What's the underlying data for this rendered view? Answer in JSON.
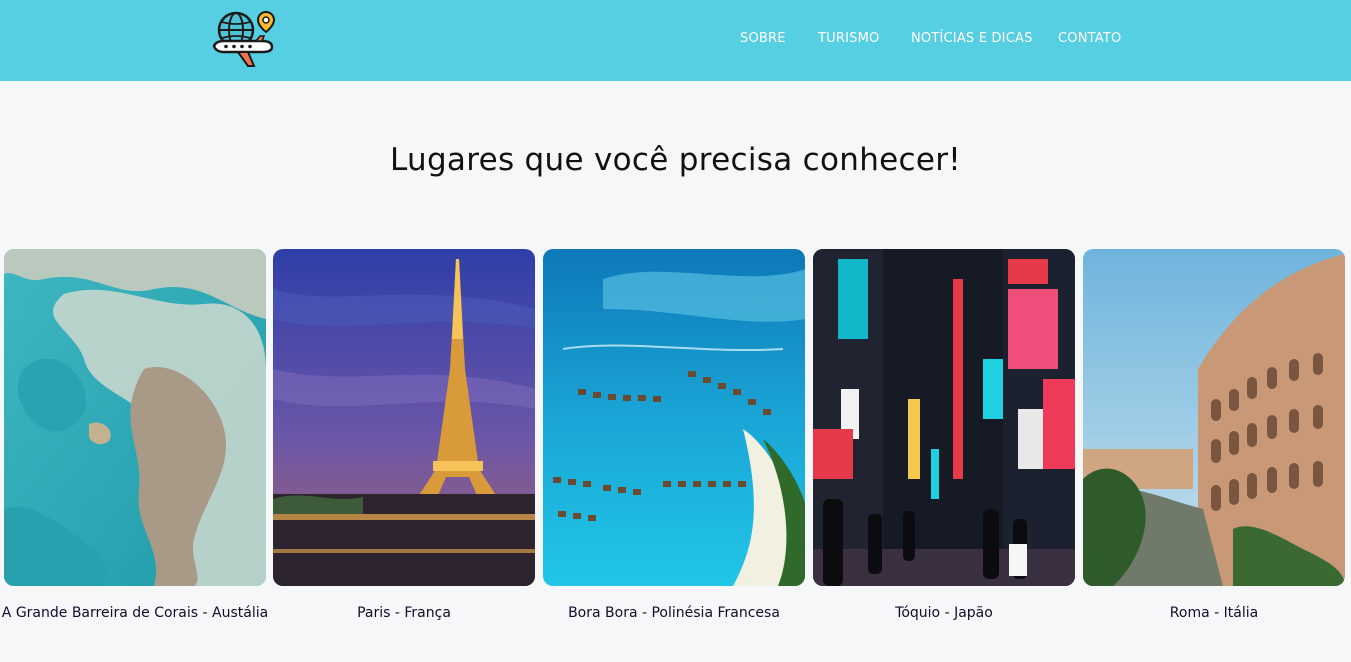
{
  "header": {
    "logo_icon": "globe-airplane-pin-icon",
    "bg_color": "#57cfe2",
    "nav": [
      {
        "label": "SOBRE"
      },
      {
        "label": "TURISMO"
      },
      {
        "label": "NOTÍCIAS E DICAS"
      },
      {
        "label": "CONTATO"
      }
    ]
  },
  "main": {
    "title": "Lugares que você precisa conhecer!",
    "places": [
      {
        "caption": "A Grande Barreira de Corais - Austália",
        "image": "coral-reef-aerial-photo"
      },
      {
        "caption": "Paris - França",
        "image": "eiffel-tower-night-photo"
      },
      {
        "caption": "Bora Bora - Polinésia Francesa",
        "image": "overwater-bungalows-photo"
      },
      {
        "caption": "Tóquio - Japão",
        "image": "tokyo-neon-street-photo"
      },
      {
        "caption": "Roma - Itália",
        "image": "colosseum-photo"
      }
    ]
  }
}
